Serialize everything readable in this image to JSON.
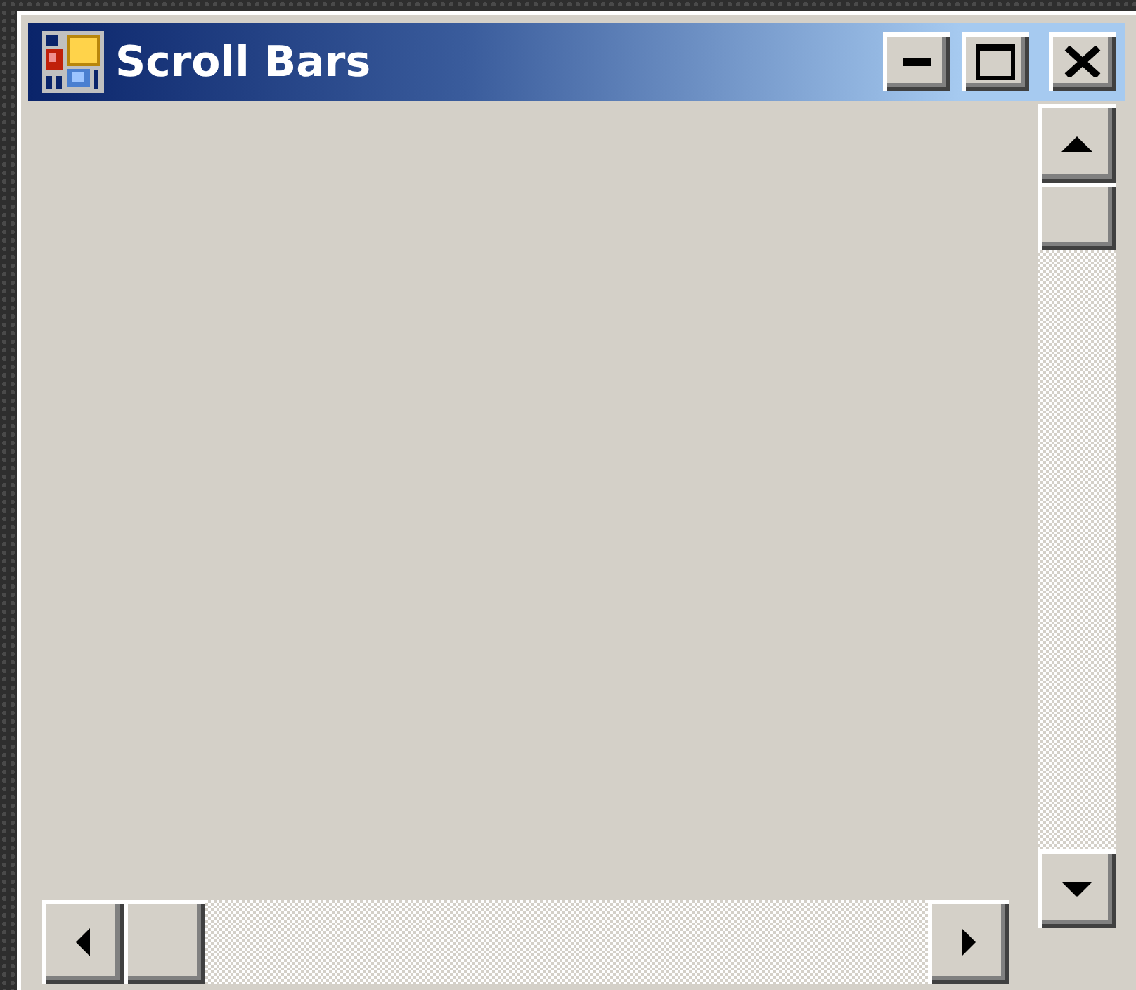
{
  "window": {
    "title": "Scroll Bars"
  }
}
